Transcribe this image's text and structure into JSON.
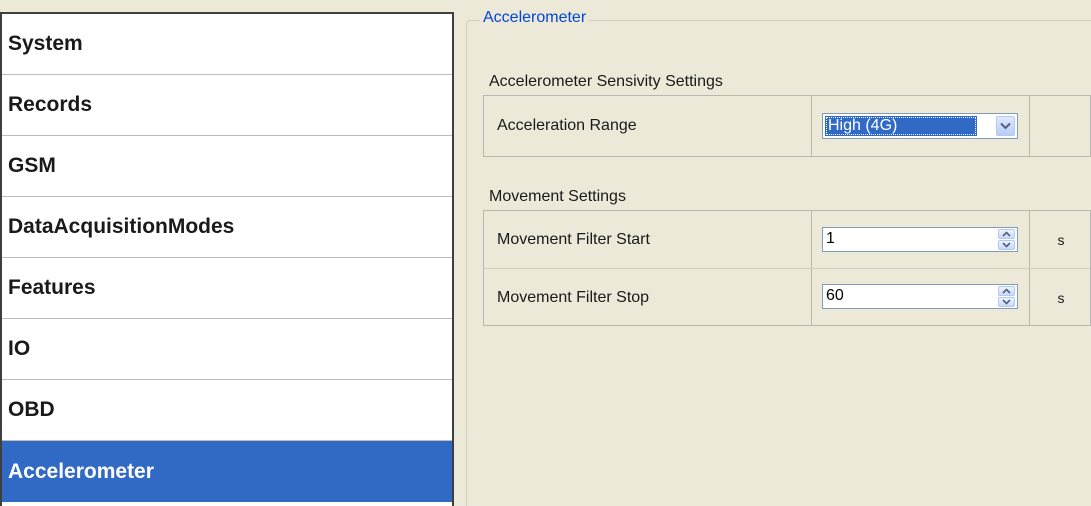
{
  "sidebar": {
    "items": [
      {
        "label": "System"
      },
      {
        "label": "Records"
      },
      {
        "label": "GSM"
      },
      {
        "label": "DataAcquisitionModes"
      },
      {
        "label": "Features"
      },
      {
        "label": "IO"
      },
      {
        "label": "OBD"
      },
      {
        "label": "Accelerometer",
        "selected": true
      }
    ]
  },
  "group": {
    "title": "Accelerometer"
  },
  "sensitivity": {
    "label": "Accelerometer Sensivity Settings",
    "acceleration_range": {
      "label": "Acceleration Range",
      "value": "High (4G)",
      "icon": "chevron-down-icon"
    }
  },
  "movement": {
    "label": "Movement Settings",
    "filter_start": {
      "label": "Movement Filter Start",
      "value": "1",
      "unit": "s"
    },
    "filter_stop": {
      "label": "Movement Filter Stop",
      "value": "60",
      "unit": "s"
    }
  },
  "colors": {
    "selection": "#316ac5",
    "group_title": "#0046d5",
    "background": "#ece9d8"
  }
}
